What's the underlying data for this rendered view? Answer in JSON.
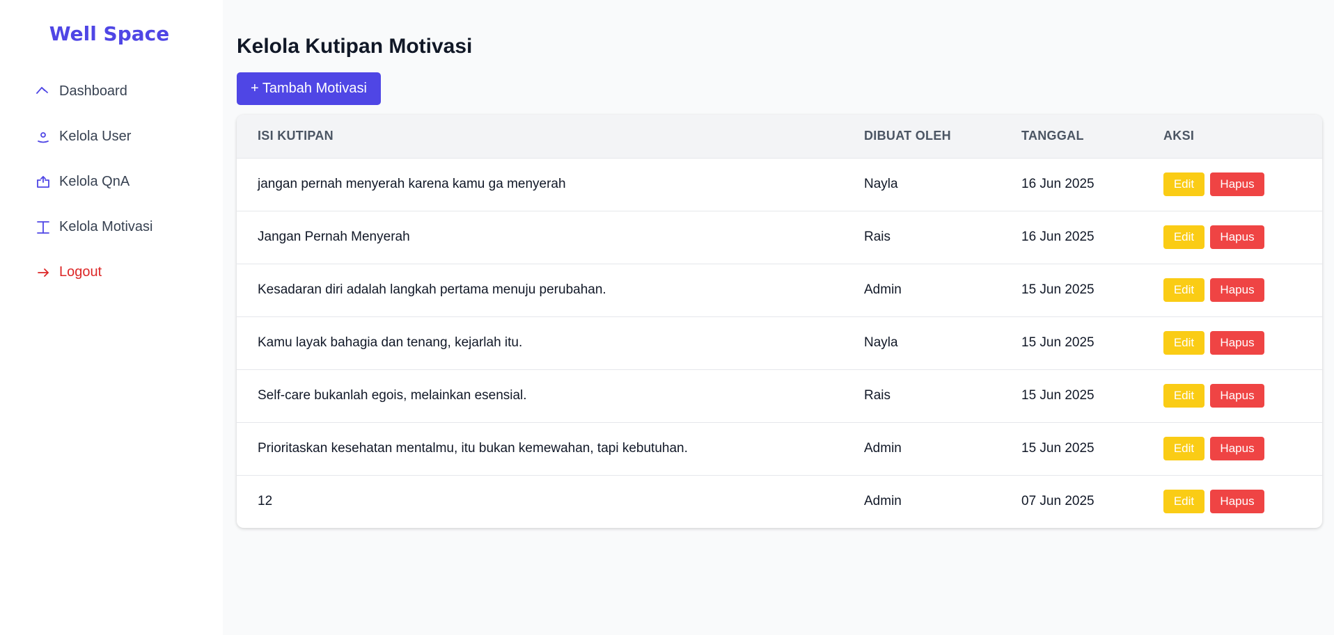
{
  "app": {
    "brand": "Well Space"
  },
  "sidebar": {
    "items": [
      {
        "label": "Dashboard",
        "icon": "dashboard-icon"
      },
      {
        "label": "Kelola User",
        "icon": "user-icon"
      },
      {
        "label": "Kelola QnA",
        "icon": "qna-icon"
      },
      {
        "label": "Kelola Motivasi",
        "icon": "motivation-icon"
      },
      {
        "label": "Logout",
        "icon": "logout-arrow-icon"
      }
    ]
  },
  "main": {
    "title": "Kelola Kutipan Motivasi",
    "add_button": "+ Tambah Motivasi",
    "table": {
      "headers": [
        "ISI KUTIPAN",
        "DIBUAT OLEH",
        "TANGGAL",
        "AKSI"
      ],
      "edit_label": "Edit",
      "delete_label": "Hapus",
      "rows": [
        {
          "quote": "jangan pernah menyerah karena kamu ga menyerah",
          "author": "Nayla",
          "date": "16 Jun 2025"
        },
        {
          "quote": "Jangan Pernah Menyerah",
          "author": "Rais",
          "date": "16 Jun 2025"
        },
        {
          "quote": "Kesadaran diri adalah langkah pertama menuju perubahan.",
          "author": "Admin",
          "date": "15 Jun 2025"
        },
        {
          "quote": "Kamu layak bahagia dan tenang, kejarlah itu.",
          "author": "Nayla",
          "date": "15 Jun 2025"
        },
        {
          "quote": "Self-care bukanlah egois, melainkan esensial.",
          "author": "Rais",
          "date": "15 Jun 2025"
        },
        {
          "quote": "Prioritaskan kesehatan mentalmu, itu bukan kemewahan, tapi kebutuhan.",
          "author": "Admin",
          "date": "15 Jun 2025"
        },
        {
          "quote": "12",
          "author": "Admin",
          "date": "07 Jun 2025"
        }
      ]
    }
  },
  "colors": {
    "accent": "#4f46e5",
    "edit": "#facc15",
    "delete": "#ef4444",
    "logout": "#dc2626"
  }
}
